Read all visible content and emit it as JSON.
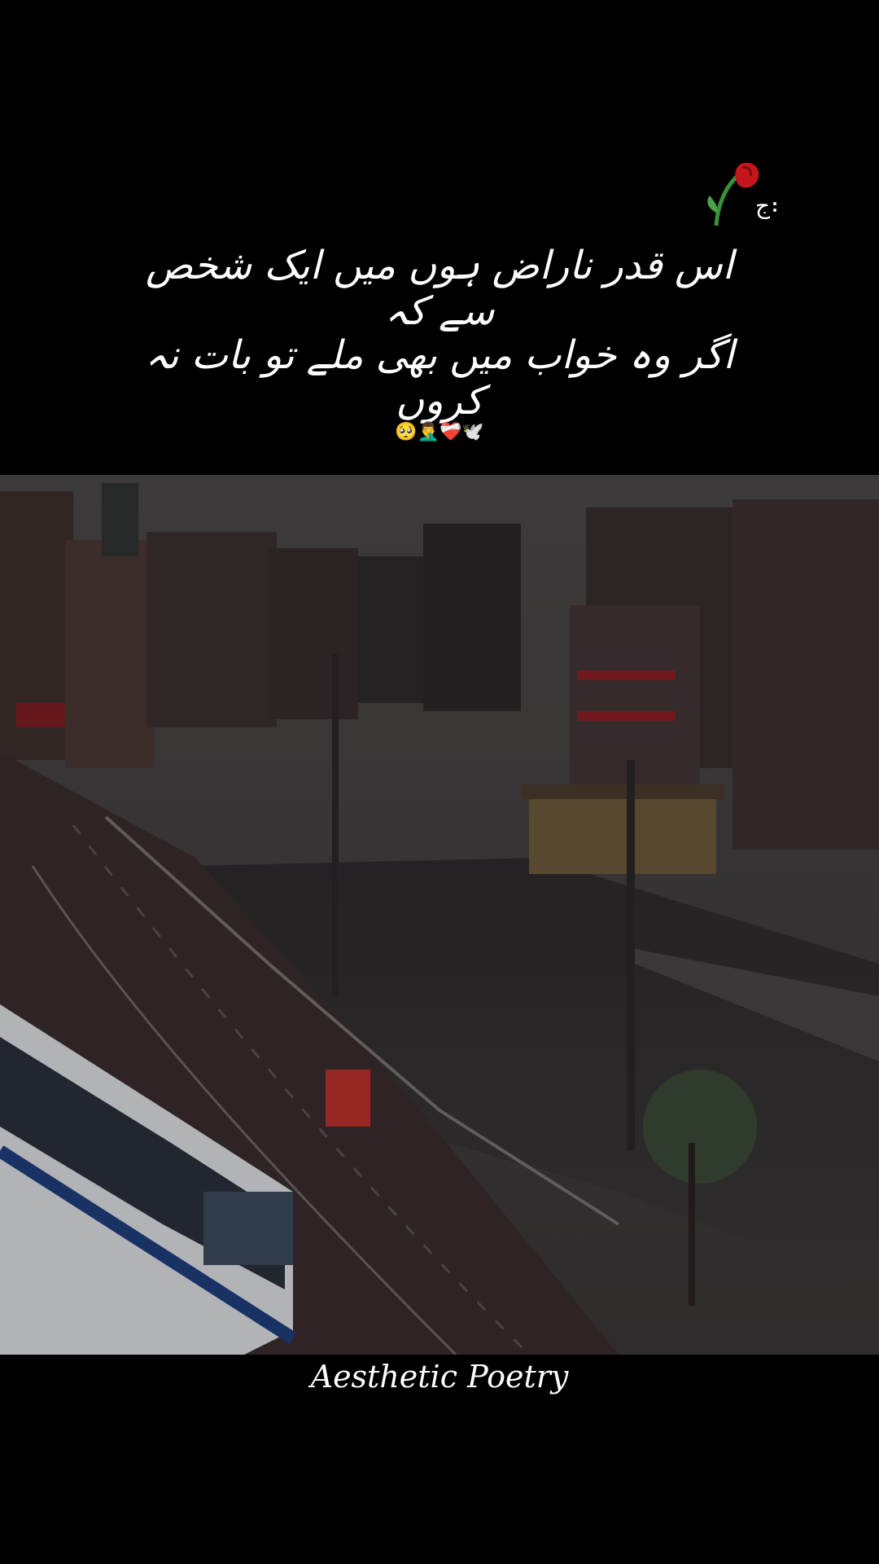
{
  "poem": {
    "line1": "اس قدر ناراض ہوں میں ایک شخص سے کہ",
    "line2": "اگر وہ خواب میں بھی ملے تو بات نہ کروں",
    "emojis": "🥺🤦‍♂️❤️‍🩹🕊️"
  },
  "watermark": "Aesthetic Poetry",
  "colors": {
    "background": "#000000",
    "text": "#ffffff",
    "rose": "#c4161c",
    "photo_tint": "#2a2728"
  }
}
